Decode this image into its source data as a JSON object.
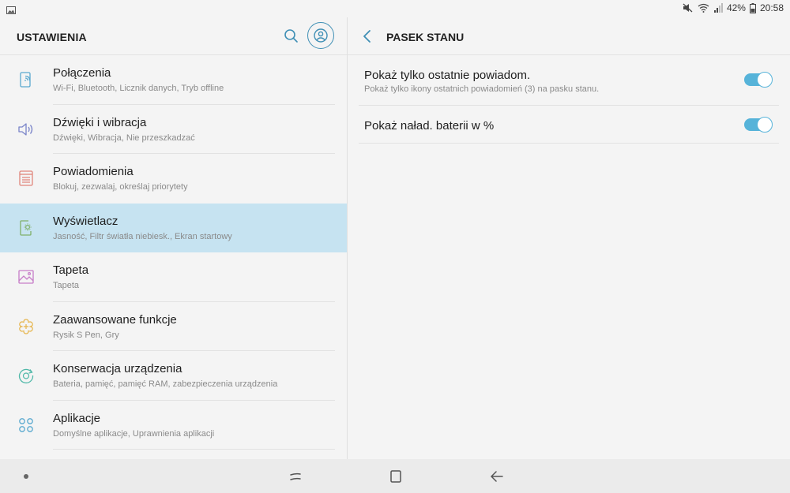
{
  "status_bar": {
    "battery": "42%",
    "time": "20:58",
    "icons": [
      "gallery-icon",
      "mute-icon",
      "wifi-icon",
      "signal-icon",
      "battery-icon"
    ]
  },
  "left_panel": {
    "title": "USTAWIENIA",
    "items": [
      {
        "title": "Połączenia",
        "subtitle": "Wi-Fi, Bluetooth, Licznik danych, Tryb offline",
        "icon": "connections-icon",
        "color": "#5aa9cf"
      },
      {
        "title": "Dźwięki i wibracja",
        "subtitle": "Dźwięki, Wibracja, Nie przeszkadzać",
        "icon": "sound-icon",
        "color": "#7a84c9"
      },
      {
        "title": "Powiadomienia",
        "subtitle": "Blokuj, zezwalaj, określaj priorytety",
        "icon": "notifications-icon",
        "color": "#e0857b"
      },
      {
        "title": "Wyświetlacz",
        "subtitle": "Jasność, Filtr światła niebiesk., Ekran startowy",
        "icon": "display-icon",
        "color": "#7fb069",
        "selected": true
      },
      {
        "title": "Tapeta",
        "subtitle": "Tapeta",
        "icon": "wallpaper-icon",
        "color": "#c77dc8"
      },
      {
        "title": "Zaawansowane funkcje",
        "subtitle": "Rysik S Pen, Gry",
        "icon": "advanced-features-icon",
        "color": "#e6b44a"
      },
      {
        "title": "Konserwacja urządzenia",
        "subtitle": "Bateria, pamięć, pamięć RAM, zabezpieczenia urządzenia",
        "icon": "device-maintenance-icon",
        "color": "#4fb8a8"
      },
      {
        "title": "Aplikacje",
        "subtitle": "Domyślne aplikacje, Uprawnienia aplikacji",
        "icon": "apps-icon",
        "color": "#5aa9cf"
      }
    ]
  },
  "right_panel": {
    "title": "PASEK STANU",
    "settings": [
      {
        "title": "Pokaż tylko ostatnie powiadom.",
        "subtitle": "Pokaż tylko ikony ostatnich powiadomień (3) na pasku stanu.",
        "enabled": true
      },
      {
        "title": "Pokaż naład. baterii w %",
        "enabled": true
      }
    ]
  },
  "colors": {
    "accent": "#56b3d9",
    "selected_bg": "#c6e3f1"
  }
}
